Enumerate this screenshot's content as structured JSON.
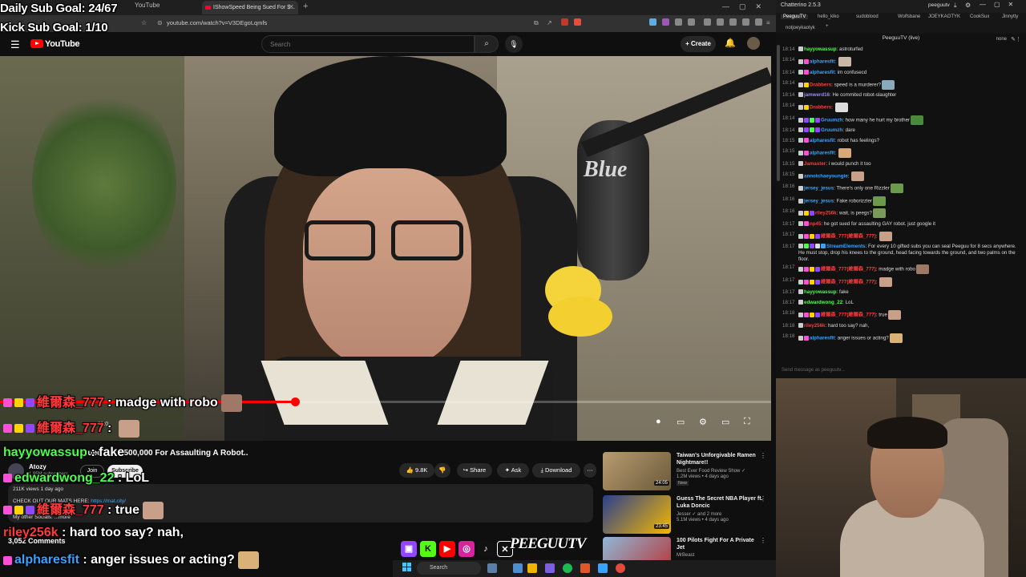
{
  "colors": {
    "youtube_red": "#ff0000",
    "chat_bg": "#111111",
    "overlay_purple": "#9146ff",
    "overlay_red": "#ff3b3b",
    "overlay_green": "#4cff4c",
    "overlay_blue": "#3aa3ff"
  },
  "browser": {
    "tab_pinned_label": "YouTube",
    "tab_active_title": "IShowSpeed Being Sued For $...",
    "url": "youtube.com/watch?v=V3DEgoLqmfs"
  },
  "youtube": {
    "logo_text": "YouTube",
    "search_placeholder": "Search",
    "create_label": "+ Create",
    "video": {
      "time_label": "11:0",
      "title": "IShowSpeed Being Sued For $500,000 For Assaulting A Robot..",
      "channel_name": "Atozy",
      "subscribers": "1.95M subscribers",
      "join_label": "Join",
      "subscribe_label": "Subscribe",
      "likes": "9.8K",
      "share_label": "Share",
      "ask_label": "Ask",
      "download_label": "Download",
      "views_line": "211K views  1 day ago",
      "desc_line2": "CHECK OUT OUR MATS HERE:",
      "desc_link": "https://mat.city/",
      "desc_line3": "My other Socials: ...more",
      "comments_count": "3,052 Comments"
    },
    "recommendations": [
      {
        "title": "Taiwan's Unforgivable Ramen Nightmare!!",
        "channel": "Best Ever Food Review Show ✓",
        "meta": "1.2M views • 4 days ago",
        "badge": "New",
        "duration": "24:05",
        "c1": "#b89b70",
        "c2": "#6b5a3a"
      },
      {
        "title": "Guess The Secret NBA Player ft. Luka Doncic",
        "channel": "Jesser ✓ and 2 more",
        "meta": "5.1M views • 4 days ago",
        "badge": "",
        "duration": "23:45",
        "c1": "#2a3f8f",
        "c2": "#f5b800"
      },
      {
        "title": "100 Pilots Fight For A Private Jet",
        "channel": "MrBeast",
        "meta": "",
        "badge": "",
        "duration": "",
        "c1": "#8fb8d9",
        "c2": "#b83232"
      }
    ]
  },
  "taskbar": {
    "search_label": "Search"
  },
  "overlay": {
    "daily_sub_goal": "Daily Sub Goal: 24/67",
    "kick_sub_goal": "Kick Sub Goal: 1/10",
    "messages": [
      {
        "user": "維爾森_777",
        "text": "madge with robo",
        "color": "#ff3b3b",
        "badges": [
          "#ff4fd8",
          "#ffd400",
          "#9146ff"
        ],
        "emote": "#a07868"
      },
      {
        "user": "維爾森_777",
        "text": "",
        "color": "#ff3b3b",
        "badges": [
          "#ff4fd8",
          "#ffd400",
          "#9146ff"
        ],
        "emote": "#c8a08a"
      },
      {
        "user": "hayyowassup",
        "text": "fake",
        "color": "#4cff4c",
        "badges": [],
        "emote": ""
      },
      {
        "user": "edwardwong_22",
        "text": "LoL",
        "color": "#4cff4c",
        "badges": [
          "#ff4fd8"
        ],
        "emote": ""
      },
      {
        "user": "維爾森_777",
        "text": "true",
        "color": "#ff3b3b",
        "badges": [
          "#ff4fd8",
          "#ffd400",
          "#9146ff"
        ],
        "emote": "#c8a08a"
      },
      {
        "user": "riley256k",
        "text": "hard too say? nah,",
        "color": "#ff3b3b",
        "badges": [],
        "emote": ""
      },
      {
        "user": "alpharesfit",
        "text": "anger issues or acting?",
        "color": "#3aa3ff",
        "badges": [
          "#ff4fd8"
        ],
        "emote": "#d9b27a"
      }
    ],
    "signature": "PEEGUUTV"
  },
  "chatterino": {
    "window_title": "Chatterino 2.5.3",
    "account": "peeguutv",
    "tabs": [
      "PeeguuTV",
      "hello_kiko",
      "sudoblood",
      "Wolfsbane",
      "JOEYKAOTYK",
      "CookSux",
      "Jinnytty"
    ],
    "tab_row2": "notjoeykaotyk",
    "channel_header": "PeeguuTV (live)",
    "mode": "none",
    "input_placeholder": "Send message as peeguutv...",
    "messages": [
      {
        "ts": "18:14",
        "user": "hayyowassup",
        "ucolor": "#4cff4c",
        "text": "astroturfed",
        "badges": [
          "#ccc"
        ],
        "emote": ""
      },
      {
        "ts": "18:14",
        "user": "alpharesfit",
        "ucolor": "#3aa3ff",
        "text": "",
        "badges": [
          "#ccc",
          "#ff4fd8"
        ],
        "emote": "#c8b8a8"
      },
      {
        "ts": "18:14",
        "user": "alpharesfit",
        "ucolor": "#3aa3ff",
        "text": "im confusecd",
        "badges": [
          "#ccc",
          "#ff4fd8"
        ],
        "emote": ""
      },
      {
        "ts": "18:14",
        "user": "Drabbers",
        "ucolor": "#ff3b3b",
        "text": "speed is a murderer?",
        "badges": [
          "#ccc",
          "#ffd400"
        ],
        "emote": "#8ab"
      },
      {
        "ts": "18:14",
        "user": "jamwerd16",
        "ucolor": "#9a8aff",
        "text": "He commited robot-slaughter",
        "badges": [
          "#ccc"
        ],
        "emote": ""
      },
      {
        "ts": "18:14",
        "user": "Drabbers",
        "ucolor": "#ff3b3b",
        "text": "",
        "badges": [
          "#ccc",
          "#ffd400"
        ],
        "emote": "#ddd"
      },
      {
        "ts": "18:14",
        "user": "Gruumzh",
        "ucolor": "#3aa3ff",
        "text": "how many he hurt my brother",
        "badges": [
          "#ccc",
          "#9146ff",
          "#4cff4c",
          "#9146ff"
        ],
        "emote": "#4a8a3a"
      },
      {
        "ts": "18:14",
        "user": "Gruumzh",
        "ucolor": "#3aa3ff",
        "text": "dare",
        "badges": [
          "#ccc",
          "#9146ff",
          "#4cff4c",
          "#9146ff"
        ],
        "emote": ""
      },
      {
        "ts": "18:15",
        "user": "alpharesfit",
        "ucolor": "#3aa3ff",
        "text": "robot has feelings?",
        "badges": [
          "#ccc",
          "#ff4fd8"
        ],
        "emote": ""
      },
      {
        "ts": "18:15",
        "user": "alpharesfit",
        "ucolor": "#3aa3ff",
        "text": "",
        "badges": [
          "#ccc",
          "#ff4fd8"
        ],
        "emote": "#d9a87a"
      },
      {
        "ts": "18:15",
        "user": "Jamaster",
        "ucolor": "#ff3b3b",
        "text": "i would punch it too",
        "badges": [
          "#ccc"
        ],
        "emote": ""
      },
      {
        "ts": "18:15",
        "user": "annotchaeyoungie",
        "ucolor": "#3aa3ff",
        "text": "",
        "badges": [
          "#ccc"
        ],
        "emote": "#c8a08a"
      },
      {
        "ts": "18:16",
        "user": "jersey_jesus",
        "ucolor": "#3aa3ff",
        "text": "There's only one Rizzler",
        "badges": [
          "#ccc"
        ],
        "emote": "#6a9a4a"
      },
      {
        "ts": "18:16",
        "user": "jersey_jesus",
        "ucolor": "#3aa3ff",
        "text": "Fake roborizzler",
        "badges": [
          "#ccc"
        ],
        "emote": "#6a9a4a"
      },
      {
        "ts": "18:16",
        "user": "riley256k",
        "ucolor": "#ff3b3b",
        "text": "wait,  is peegs?",
        "badges": [
          "#ccc",
          "#ffd400",
          "#9146ff"
        ],
        "emote": "#7a9a5a"
      },
      {
        "ts": "18:17",
        "user": "np45",
        "ucolor": "#ff3b3b",
        "text": "he got sued for assaulting GAY robot. just google it",
        "badges": [
          "#ccc",
          "#ff4fd8"
        ],
        "emote": ""
      },
      {
        "ts": "18:17",
        "user": "維爾森_777(維爾森_777)",
        "ucolor": "#ff3b3b",
        "text": "",
        "badges": [
          "#ccc",
          "#ff4fd8",
          "#ffd400",
          "#9146ff"
        ],
        "emote": "#c8a08a"
      },
      {
        "ts": "18:17",
        "user": "StreamElements",
        "ucolor": "#3aa3ff",
        "text": "For every 10 gifted subs you can seal Peeguu for 8 secs anywhere. He must stop, drop his knees to the ground, head facing towards the ground, and two palms on the floor.",
        "badges": [
          "#ccc",
          "#4cff4c",
          "#9146ff",
          "#ddd",
          "#3aa3ff"
        ],
        "emote": ""
      },
      {
        "ts": "18:17",
        "user": "維爾森_777(維爾森_777)",
        "ucolor": "#ff3b3b",
        "text": "madge with robo",
        "badges": [
          "#ccc",
          "#ff4fd8",
          "#ffd400",
          "#9146ff"
        ],
        "emote": "#a07868"
      },
      {
        "ts": "18:17",
        "user": "維爾森_777(維爾森_777)",
        "ucolor": "#ff3b3b",
        "text": "",
        "badges": [
          "#ccc",
          "#ff4fd8",
          "#ffd400",
          "#9146ff"
        ],
        "emote": "#c8a08a"
      },
      {
        "ts": "18:17",
        "user": "hayyowassup",
        "ucolor": "#4cff4c",
        "text": "fake",
        "badges": [
          "#ccc"
        ],
        "emote": ""
      },
      {
        "ts": "18:17",
        "user": "edwardwong_22",
        "ucolor": "#4cff4c",
        "text": "LoL",
        "badges": [
          "#ccc"
        ],
        "emote": ""
      },
      {
        "ts": "18:18",
        "user": "維爾森_777(維爾森_777)",
        "ucolor": "#ff3b3b",
        "text": "true",
        "badges": [
          "#ccc",
          "#ff4fd8",
          "#ffd400",
          "#9146ff"
        ],
        "emote": "#c8a08a"
      },
      {
        "ts": "18:18",
        "user": "riley256k",
        "ucolor": "#ff3b3b",
        "text": "hard too say? nah,",
        "badges": [
          "#ccc"
        ],
        "emote": ""
      },
      {
        "ts": "18:18",
        "user": "alpharesfit",
        "ucolor": "#3aa3ff",
        "text": "anger issues or acting?",
        "badges": [
          "#ccc",
          "#ff4fd8"
        ],
        "emote": "#d9b27a"
      }
    ]
  }
}
